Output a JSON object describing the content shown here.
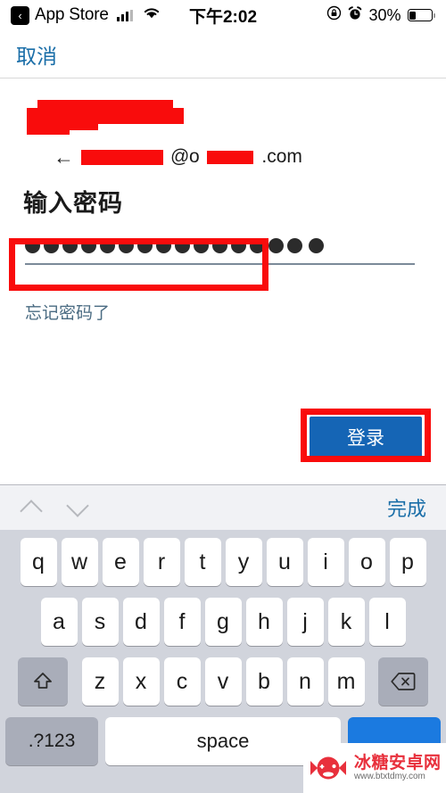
{
  "status_bar": {
    "back_app_label": "App Store",
    "back_chevron": "‹",
    "time": "下午2:02",
    "battery_percent_label": "30%",
    "battery_level": 30,
    "rotation_lock_icon": "rotation-lock-icon",
    "alarm_icon": "alarm-clock-icon",
    "wifi_icon": "wifi-icon",
    "signal_icon": "cellular-signal-icon"
  },
  "nav": {
    "cancel_label": "取消"
  },
  "account": {
    "brand_redacted": true,
    "back_arrow": "←",
    "email_domain_suffix": ".com",
    "email_at": "@o",
    "email_redacted": true
  },
  "form": {
    "heading": "输入密码",
    "password_dot_count": 15,
    "password_dot_glyph": "●",
    "forgot_label": "忘记密码了",
    "signin_label": "登录"
  },
  "annotations": {
    "password_box_color": "#f90c0c",
    "signin_box_color": "#f90c0c"
  },
  "keyboard": {
    "accessory": {
      "prev_icon": "chevron-up-icon",
      "next_icon": "chevron-down-icon",
      "done_label": "完成"
    },
    "row1": [
      "q",
      "w",
      "e",
      "r",
      "t",
      "y",
      "u",
      "i",
      "o",
      "p"
    ],
    "row2": [
      "a",
      "s",
      "d",
      "f",
      "g",
      "h",
      "j",
      "k",
      "l"
    ],
    "row3": [
      "z",
      "x",
      "c",
      "v",
      "b",
      "n",
      "m"
    ],
    "shift_icon": "shift-arrow-icon",
    "delete_icon": "backspace-delete-icon",
    "numbers_label": ".?123",
    "space_label": "space",
    "go_label": ""
  },
  "watermark": {
    "title": "冰糖安卓网",
    "url": "www.btxtdmy.com",
    "logo_icon": "candy-gamepad-logo-icon"
  },
  "colors": {
    "link_blue": "#1a6ea8",
    "button_blue": "#1565b5",
    "annotation_red": "#f90c0c",
    "keyboard_bg": "#d1d4dc"
  }
}
